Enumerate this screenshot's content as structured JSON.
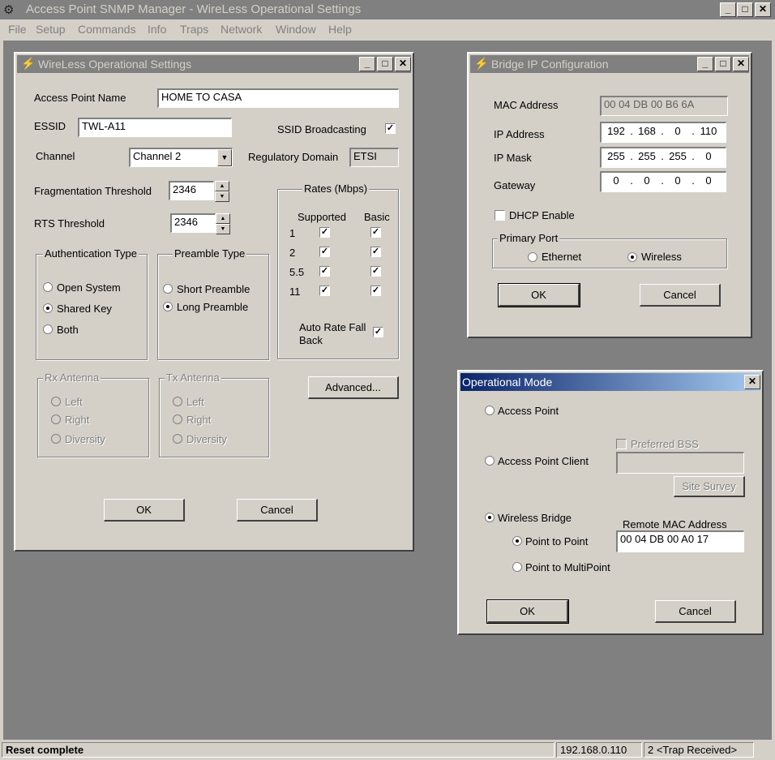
{
  "app": {
    "title": "Access Point SNMP Manager -  WireLess Operational Settings",
    "menu": [
      "File",
      "Setup",
      "Commands",
      "Info",
      "Traps",
      "Network",
      "Window",
      "Help"
    ]
  },
  "wireless": {
    "title": "WireLess Operational Settings",
    "ap_name_label": "Access Point Name",
    "ap_name": "HOME TO CASA",
    "essid_label": "ESSID",
    "essid": "TWL-A11",
    "ssid_broadcast_label": "SSID Broadcasting",
    "channel_label": "Channel",
    "channel": "Channel 2",
    "reg_domain_label": "Regulatory Domain",
    "reg_domain": "ETSI",
    "frag_label": "Fragmentation Threshold",
    "frag": "2346",
    "rts_label": "RTS Threshold",
    "rts": "2346",
    "rates": {
      "title": "Rates (Mbps)",
      "supported": "Supported",
      "basic": "Basic",
      "rows": [
        "1",
        "2",
        "5.5",
        "11"
      ],
      "auto_fallback_1": "Auto Rate Fall",
      "auto_fallback_2": "Back"
    },
    "auth": {
      "title": "Authentication Type",
      "open": "Open System",
      "shared": "Shared Key",
      "both": "Both"
    },
    "preamble": {
      "title": "Preamble Type",
      "short": "Short Preamble",
      "long": "Long Preamble"
    },
    "rx": {
      "title": "Rx Antenna",
      "left": "Left",
      "right": "Right",
      "diversity": "Diversity"
    },
    "tx": {
      "title": "Tx Antenna",
      "left": "Left",
      "right": "Right",
      "diversity": "Diversity"
    },
    "advanced": "Advanced...",
    "ok": "OK",
    "cancel": "Cancel"
  },
  "bridge": {
    "title": "Bridge IP Configuration",
    "mac_label": "MAC Address",
    "mac": "00 04 DB 00 B6 6A",
    "ip_label": "IP Address",
    "ip": [
      "192",
      "168",
      "0",
      "110"
    ],
    "mask_label": "IP Mask",
    "mask": [
      "255",
      "255",
      "255",
      "0"
    ],
    "gw_label": "Gateway",
    "gw": [
      "0",
      "0",
      "0",
      "0"
    ],
    "dhcp_label": "DHCP Enable",
    "primary_port": "Primary Port",
    "ethernet": "Ethernet",
    "wireless": "Wireless",
    "ok": "OK",
    "cancel": "Cancel"
  },
  "opmode": {
    "title": "Operational Mode",
    "ap": "Access Point",
    "preferred_bss": "Preferred BSS",
    "ap_client": "Access Point Client",
    "site_survey": "Site Survey",
    "wireless_bridge": "Wireless Bridge",
    "remote_mac_label": "Remote MAC Address",
    "p2p": "Point to Point",
    "remote_mac": "00 04 DB 00 A0 17",
    "p2mp": "Point to MultiPoint",
    "ok": "OK",
    "cancel": "Cancel"
  },
  "status": {
    "message": "Reset complete",
    "ip": "192.168.0.110",
    "traps": "2 <Trap Received>"
  }
}
